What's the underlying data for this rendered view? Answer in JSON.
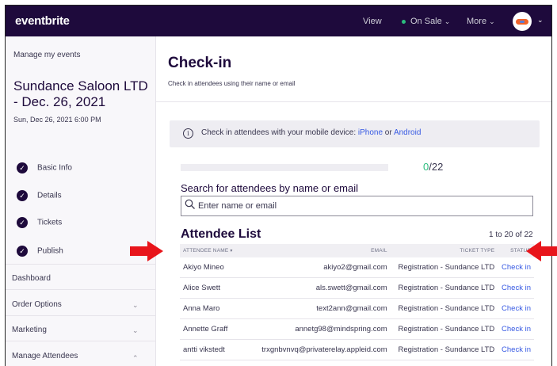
{
  "topbar": {
    "logo": "eventbrite",
    "view": "View",
    "status": "On Sale",
    "more": "More",
    "status_color": "#2bbd7e"
  },
  "sidebar": {
    "manage_link": "Manage my events",
    "event_name": "Sundance Saloon LTD - Dec. 26, 2021",
    "event_date": "Sun, Dec 26, 2021 6:00 PM",
    "steps": [
      {
        "label": "Basic Info"
      },
      {
        "label": "Details"
      },
      {
        "label": "Tickets"
      },
      {
        "label": "Publish"
      }
    ],
    "items": [
      {
        "label": "Dashboard"
      },
      {
        "label": "Order Options"
      },
      {
        "label": "Marketing"
      },
      {
        "label": "Manage Attendees"
      }
    ]
  },
  "main": {
    "title": "Check-in",
    "subtitle": "Check in attendees using their name or email",
    "banner": {
      "text": "Check in attendees with your mobile device: ",
      "iphone": "iPhone",
      "or": " or ",
      "android": "Android"
    },
    "progress": {
      "checked_in": "0",
      "total": "/22",
      "fraction": 0
    },
    "search": {
      "label": "Search for attendees by name or email",
      "placeholder": "Enter name or email"
    },
    "list": {
      "title": "Attendee List",
      "range": "1 to 20 of 22",
      "columns": {
        "name": "ATTENDEE NAME",
        "email": "EMAIL",
        "type": "TICKET TYPE",
        "status": "STATUS"
      },
      "rows": [
        {
          "name": "Akiyo Mineo",
          "email": "akiyo2@gmail.com",
          "type": "Registration - Sundance LTD",
          "status": "Check in"
        },
        {
          "name": "Alice Swett",
          "email": "als.swett@gmail.com",
          "type": "Registration - Sundance LTD",
          "status": "Check in"
        },
        {
          "name": "Anna Maro",
          "email": "text2ann@gmail.com",
          "type": "Registration - Sundance LTD",
          "status": "Check in"
        },
        {
          "name": "Annette Graff",
          "email": "annetg98@mindspring.com",
          "type": "Registration - Sundance LTD",
          "status": "Check in"
        },
        {
          "name": "antti vikstedt",
          "email": "trxgnbvnvq@privaterelay.appleid.com",
          "type": "Registration - Sundance LTD",
          "status": "Check in"
        }
      ]
    }
  },
  "colors": {
    "brand_dark": "#1e0a3c",
    "link": "#3659e3",
    "arrow": "#e8151b"
  }
}
